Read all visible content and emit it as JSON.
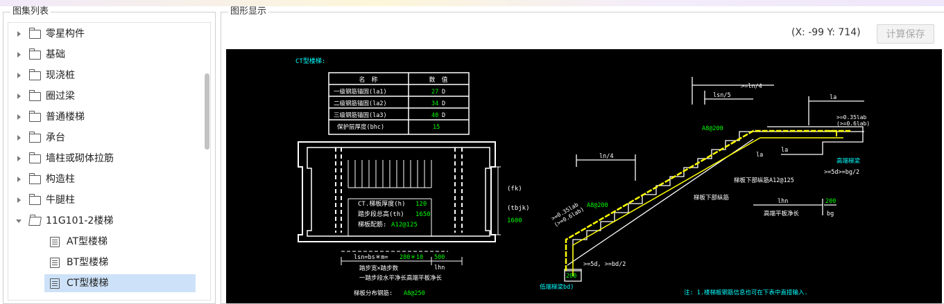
{
  "left_panel": {
    "title": "图集列表",
    "tree": [
      {
        "label": "零星构件",
        "type": "folder",
        "expanded": false
      },
      {
        "label": "基础",
        "type": "folder",
        "expanded": false
      },
      {
        "label": "现浇桩",
        "type": "folder",
        "expanded": false
      },
      {
        "label": "圈过梁",
        "type": "folder",
        "expanded": false
      },
      {
        "label": "普通楼梯",
        "type": "folder",
        "expanded": false
      },
      {
        "label": "承台",
        "type": "folder",
        "expanded": false
      },
      {
        "label": "墙柱或砌体拉筋",
        "type": "folder",
        "expanded": false
      },
      {
        "label": "构造柱",
        "type": "folder",
        "expanded": false
      },
      {
        "label": "牛腿柱",
        "type": "folder",
        "expanded": false
      },
      {
        "label": "11G101-2楼梯",
        "type": "folder",
        "expanded": true
      },
      {
        "label": "AT型楼梯",
        "type": "document"
      },
      {
        "label": "BT型楼梯",
        "type": "document"
      },
      {
        "label": "CT型楼梯",
        "type": "document",
        "selected": true
      }
    ]
  },
  "right_panel": {
    "title": "图形显示",
    "coord_text": "(X: -99 Y: 714)",
    "calc_save_label": "计算保存"
  },
  "drawing": {
    "caption": "CT型楼梯:",
    "table_headers": [
      "名　称",
      "数　值"
    ],
    "table_rows": [
      {
        "name": "一级钢筋锚固(la1)",
        "value": "27",
        "unit": "D"
      },
      {
        "name": "二级钢筋锚固(la2)",
        "value": "34",
        "unit": "D"
      },
      {
        "name": "三级钢筋锚固(la3)",
        "value": "40",
        "unit": "D"
      },
      {
        "name": "保护层厚度(bhc)",
        "value": "15",
        "unit": ""
      }
    ],
    "plan": {
      "fk": "(fk)",
      "tbjk": "(tbjk)",
      "tbjk_value": "1600",
      "thickness_label": "CT.梯板厚度(h)",
      "thickness_value": "120",
      "step_height_label": "踏步段总高(th)",
      "step_height_value": "1650",
      "rebar_label": "梯板配筋:",
      "rebar_value": "A12@125",
      "dim_lsn": "lsn=bs＊m=",
      "dim_lsn_value": "280＊10",
      "dim_500": "500",
      "dim_lhn": "lhn",
      "note_1": "踏步宽×踏步数",
      "note_2": "一踏步段水平净长高端平板净长",
      "dist_label": "梯板分布钢筋:",
      "dist_value": "A8@250"
    },
    "section": {
      "dim_ln4_top": ">=ln/4",
      "dim_lsn5": "lsn/5",
      "dim_la": "la",
      "r1": ">=0.35lab",
      "r2": "(>=0.6lab)",
      "a8_top": "A8@200",
      "high_beam": "高端梯梁",
      "r3": ">=5d>=bg/2",
      "la_small_1": "la",
      "la_small_2": "la",
      "bottom_rebar": "梯板下部纵筋A12@125",
      "bottom_rebar_2": "梯板下部纵筋",
      "ln4": "ln/4",
      "a8_mid": "A8@200",
      "r4": ">=0.35lab",
      "r5": "(>=0.6lab)",
      "lhn": "lhn",
      "v200": "200",
      "high_len": "高端平板净长",
      "bg": "bg",
      "r6": ">=5d, >=bd/2",
      "v200b": "200",
      "low_beam": "低端梯梁bd)",
      "note": "注: 1.楼梯板钢筋信息也可在下表中直接输入."
    }
  },
  "colors": {
    "canvas": "#000000",
    "line": "#ffffff",
    "value_green": "#00ff00",
    "caption_cyan": "#00ffff",
    "rebar_yellow": "#ffff00",
    "selection": "#cde2f8"
  },
  "icons": {
    "collapsed": "caret-right-icon",
    "expanded": "caret-down-icon",
    "folder": "folder-icon",
    "document": "document-icon"
  }
}
